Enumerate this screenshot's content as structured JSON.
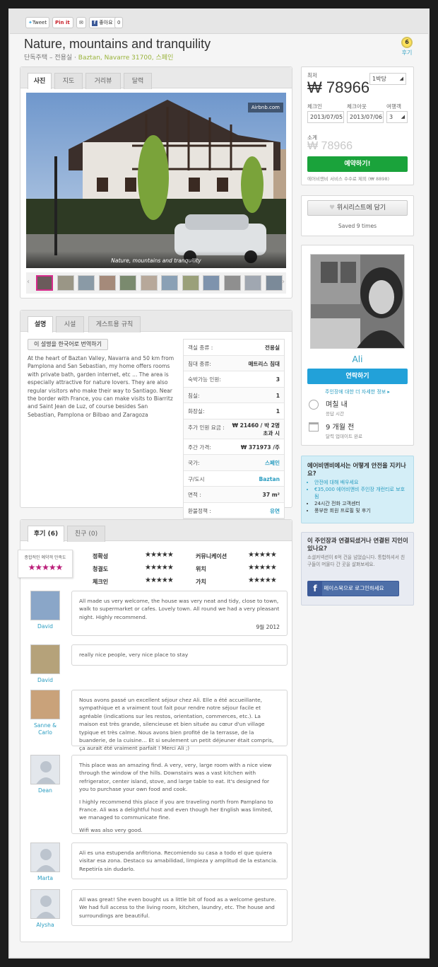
{
  "share": {
    "tweet": "Tweet",
    "pin": "Pin it",
    "mail": "✉",
    "like": "좋아요",
    "like_count": "0"
  },
  "listing": {
    "title": "Nature, mountains and tranquility",
    "subtitle_prefix": "단독주택 – 전용실 · ",
    "location": "Baztan, Navarre 31700, 스페인",
    "wishlist_count": "6",
    "wishlist_label": "후기"
  },
  "photo_tabs": [
    "사진",
    "지도",
    "거리뷰",
    "달력"
  ],
  "photo": {
    "watermark": "Airbnb.com",
    "caption": "Nature, mountains and tranquility",
    "thumb_count": 12
  },
  "description": {
    "tabs": [
      "설명",
      "시설",
      "게스트용 규칙"
    ],
    "translate_button": "이 설명을 한국어로 번역하기",
    "text": "At the heart of Baztan Valley, Navarra and 50 km from Pamplona and San Sebastian, my home offers rooms with private bath, garden internet, etc ... The area is especially attractive for nature lovers. They are also regular visitors who make their way to Santiago. Near the border with France, you can make visits to Biarritz and Saint Jean de Luz, of course besides San Sebastian, Pamplona or Bilbao and Zaragoza",
    "details": [
      {
        "key": "객실 종류 :",
        "value": "전용실",
        "link": false
      },
      {
        "key": "침대 종류:",
        "value": "매트리스 침대",
        "link": false
      },
      {
        "key": "숙박가능 인원:",
        "value": "3",
        "link": false
      },
      {
        "key": "침실:",
        "value": "1",
        "link": false
      },
      {
        "key": "화장실:",
        "value": "1",
        "link": false
      },
      {
        "key": "추가 인원 요금 :",
        "value": "₩ 21460 / 박 2명 초과 시",
        "link": false
      },
      {
        "key": "주간 가격:",
        "value": "₩ 371973 /주",
        "link": false
      },
      {
        "key": "국가:",
        "value": "스페인",
        "link": true
      },
      {
        "key": "구/도시",
        "value": "Baztan",
        "link": true
      },
      {
        "key": "면적 :",
        "value": "37 m²",
        "link": false
      },
      {
        "key": "환불정책 :",
        "value": "유연",
        "link": true
      }
    ]
  },
  "reviews": {
    "tabs": [
      "후기 (6)",
      "친구 (0)"
    ],
    "overall_label": "종합적인 예약객 만족도",
    "overall_stars": "★★★★★",
    "ratings": [
      {
        "name": "정확성",
        "stars": "★★★★★"
      },
      {
        "name": "커뮤니케이션",
        "stars": "★★★★★"
      },
      {
        "name": "청결도",
        "stars": "★★★★★"
      },
      {
        "name": "위치",
        "stars": "★★★★★"
      },
      {
        "name": "체크인",
        "stars": "★★★★★"
      },
      {
        "name": "가치",
        "stars": "★★★★★"
      }
    ],
    "items": [
      {
        "name": "David",
        "paragraphs": [
          "All made us very welcome, the house was very neat and tidy, close to town, walk to supermarket or cafes. Lovely town. All round we had a very pleasant night. Highly recommend."
        ],
        "date": "9월 2012"
      },
      {
        "name": "David",
        "paragraphs": [
          "really nice people, very nice place to stay"
        ],
        "date": ""
      },
      {
        "name": "Sanne & Carlo",
        "paragraphs": [
          "Nous avons passé un excellent séjour chez Ali. Elle a été accueillante, sympathique et a vraiment tout fait pour rendre notre séjour facile et agréable (indications sur les restos, orientation, commerces, etc.). La maison est très grande, silencieuse et bien située au cœur d'un village typique et très calme. Nous avons bien profité de la terrasse, de la buanderie, de la cuisine… Et si seulement un petit déjeuner était compris, ça aurait été vraiment parfait ! Merci Ali ;)"
        ],
        "date": ""
      },
      {
        "name": "Dean",
        "paragraphs": [
          "This place was an amazing find. A very, very, large room with a nice view through the window of the hills. Downstairs was a vast kitchen with refrigerator, center island, stove, and large table to eat. It's designed for you to purchase your own food and cook.",
          "I highly recommend this place if you are traveling north from Pamplano to France. Ali was a delightful host and even though her English was limited, we managed to communicate fine.",
          "Wifi was also very good."
        ],
        "date": ""
      },
      {
        "name": "Marta",
        "paragraphs": [
          "Ali es una estupenda anfitriona. Recomiendo su casa a todo el que quiera visitar esa zona. Destaco su amabilidad, limpieza y amplitud de la estancia. Repetiría sin dudarlo."
        ],
        "date": ""
      },
      {
        "name": "Alysha",
        "paragraphs": [
          "All was great! She even bought us a little bit of food as a welcome gesture. We had full access to the living room, kitchen, laundry, etc. The house and surroundings are beautiful."
        ],
        "date": ""
      }
    ]
  },
  "booking": {
    "price_label": "최저",
    "price": "₩ 78966",
    "per_select": "1박당",
    "checkin_label": "체크인",
    "checkout_label": "체크아웃",
    "guests_label": "여행객",
    "checkin": "2013/07/05",
    "checkout": "2013/07/06",
    "guests": "3",
    "subtotal_label": "소계",
    "subtotal": "₩ 78966",
    "book_button": "예약하기!",
    "fee_note": "에어비앤비 서비스 수수료 제외 (₩ 8898)"
  },
  "wishlist": {
    "button": "위시리스트에 담기",
    "saved": "Saved 9 times"
  },
  "host": {
    "name": "Ali",
    "contact_button": "연락하기",
    "more_link": "주인장에 대한 더 자세한 정보 ▸",
    "response_time": "며칠 내",
    "response_label": "응답 시간",
    "member_since": "9 개월 전",
    "member_label": "달력 업데이트 완료"
  },
  "safety": {
    "title": "에어비앤비에서는 어떻게 안전을 지키나요?",
    "items": [
      "안전에 대해 배우세요",
      "€35,000 에어비앤비 주인장 개런티로 보호됨",
      "24시간 전화 고객센터",
      "풍부한 회원 프로필 및 후기"
    ]
  },
  "social": {
    "title": "이 주인장과 연결되셨거나 연결된 지인이 있나요?",
    "text": "소셜커넥션이 6억 건을 넘었습니다. 통합하셔서 친구들이 머물다 간 곳을 살펴보세요.",
    "fb_button": "페이스북으로 로그인하세요"
  },
  "colors": {
    "accent_green": "#1aa33b",
    "accent_blue": "#22a1d9",
    "star_pink": "#bb1f7a",
    "link_blue": "#2a9dc1"
  }
}
